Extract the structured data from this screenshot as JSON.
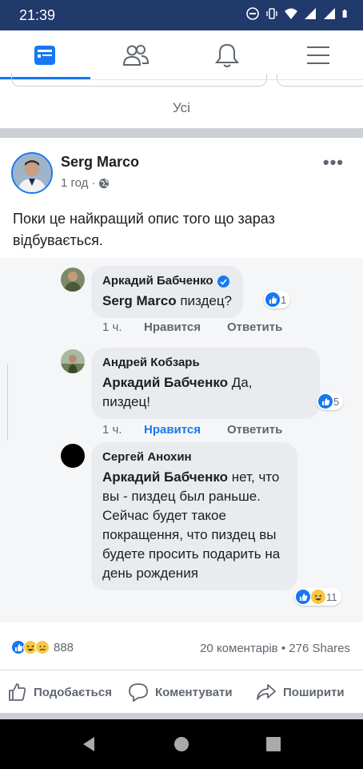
{
  "status_bar": {
    "time": "21:39"
  },
  "filter": {
    "label": "Усі"
  },
  "post": {
    "author": "Serg Marco",
    "time": "1 год",
    "text": "Поки це найкращий опис того що зараз відбувається.",
    "comments": [
      {
        "name": "Аркадий Бабченко",
        "verified": true,
        "mention": "Serg Marco",
        "text": "пиздец?",
        "reactions": "1",
        "time": "1 ч.",
        "like": "Нравится",
        "reply": "Ответить"
      },
      {
        "name": "Андрей Кобзарь",
        "mention": "Аркадий Бабченко",
        "text": "Да, пиздец!",
        "text_line1": "Да,",
        "text_line2": "пиздец!",
        "reactions": "5",
        "time": "1 ч.",
        "like": "Нравится",
        "reply": "Ответить"
      },
      {
        "name": "Сергей Анохин",
        "mention": "Аркадий Бабченко",
        "text": "нет, что вы - пиздец был раньше. Сейчас будет такое покращення, что пиздец вы будете просить подарить на день рождения",
        "text_line1": "нет,",
        "text_rest": "что вы - пиздец был раньше. Сейчас будет такое покращення, что пиздец вы будете просить подарить на день рождения",
        "reactions": "11"
      }
    ],
    "summary": {
      "reaction_count": "888",
      "comments": "20 коментарів",
      "separator": "•",
      "shares": "276 Shares"
    },
    "actions": {
      "like": "Подобається",
      "comment": "Коментувати",
      "share": "Поширити"
    }
  },
  "colors": {
    "accent": "#1877f2",
    "status_bar": "#1f3a6b",
    "bubble": "#e9ebee",
    "secondary_text": "#606770"
  }
}
